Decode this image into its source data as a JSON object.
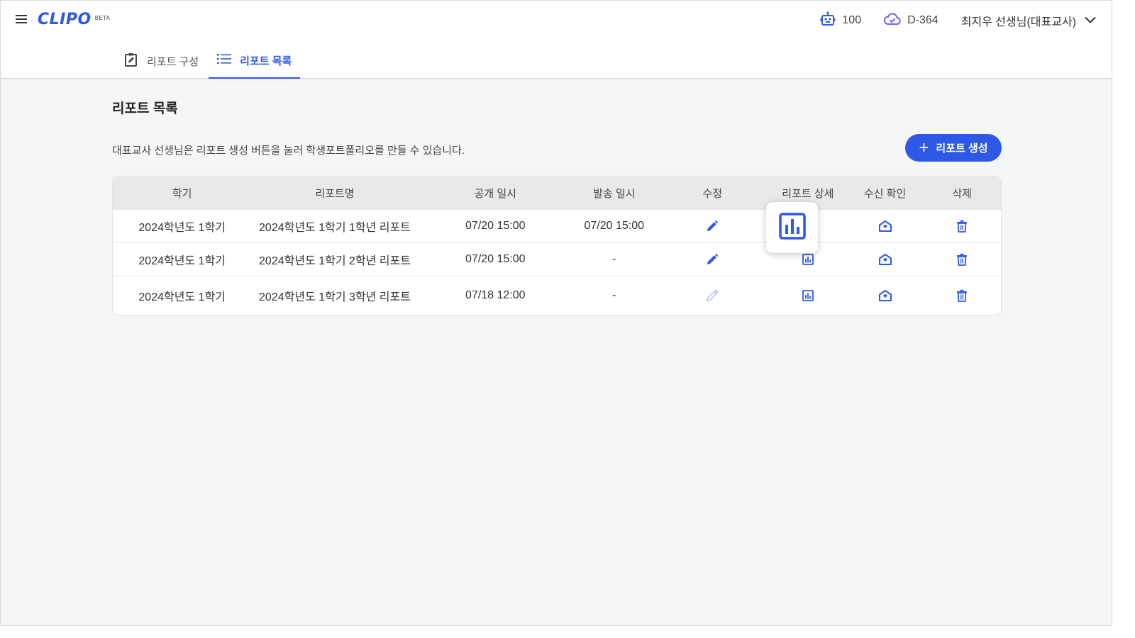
{
  "app": {
    "logo": "CLIPO",
    "beta": "BETA"
  },
  "header": {
    "robot_count": "100",
    "storage_days": "D-364",
    "user_name": "최지우 선생님(대표교사)"
  },
  "tabs": [
    {
      "label": "리포트 구성",
      "active": false
    },
    {
      "label": "리포트 목록",
      "active": true
    }
  ],
  "page": {
    "title": "리포트 목록",
    "description": "대표교사 선생님은 리포트 생성 버튼을 눌러 학생포트폴리오를 만들 수 있습니다.",
    "create_button": "리포트 생성"
  },
  "table": {
    "columns": [
      "학기",
      "리포트명",
      "공개 일시",
      "발송 일시",
      "수정",
      "리포트 상세",
      "수신 확인",
      "삭제"
    ],
    "rows": [
      {
        "semester": "2024학년도 1학기",
        "name": "2024학년도 1학기 1학년 리포트",
        "open": "07/20 15:00",
        "sent": "07/20 15:00",
        "edit_enabled": true
      },
      {
        "semester": "2024학년도 1학기",
        "name": "2024학년도 1학기 2학년 리포트",
        "open": "07/20 15:00",
        "sent": "-",
        "edit_enabled": true
      },
      {
        "semester": "2024학년도 1학기",
        "name": "2024학년도 1학기 3학년 리포트",
        "open": "07/18 12:00",
        "sent": "-",
        "edit_enabled": false
      }
    ]
  },
  "colors": {
    "accent": "#2e59e6",
    "accent_disabled": "#9fb3f0",
    "storage_icon": "#7b5cf0"
  },
  "icons": [
    "menu-icon",
    "robot-icon",
    "cloud-check-icon",
    "chevron-down-icon",
    "edit-note-icon",
    "list-icon",
    "plus-icon",
    "pencil-icon",
    "bar-chart-icon",
    "mail-open-heart-icon",
    "trash-icon"
  ]
}
